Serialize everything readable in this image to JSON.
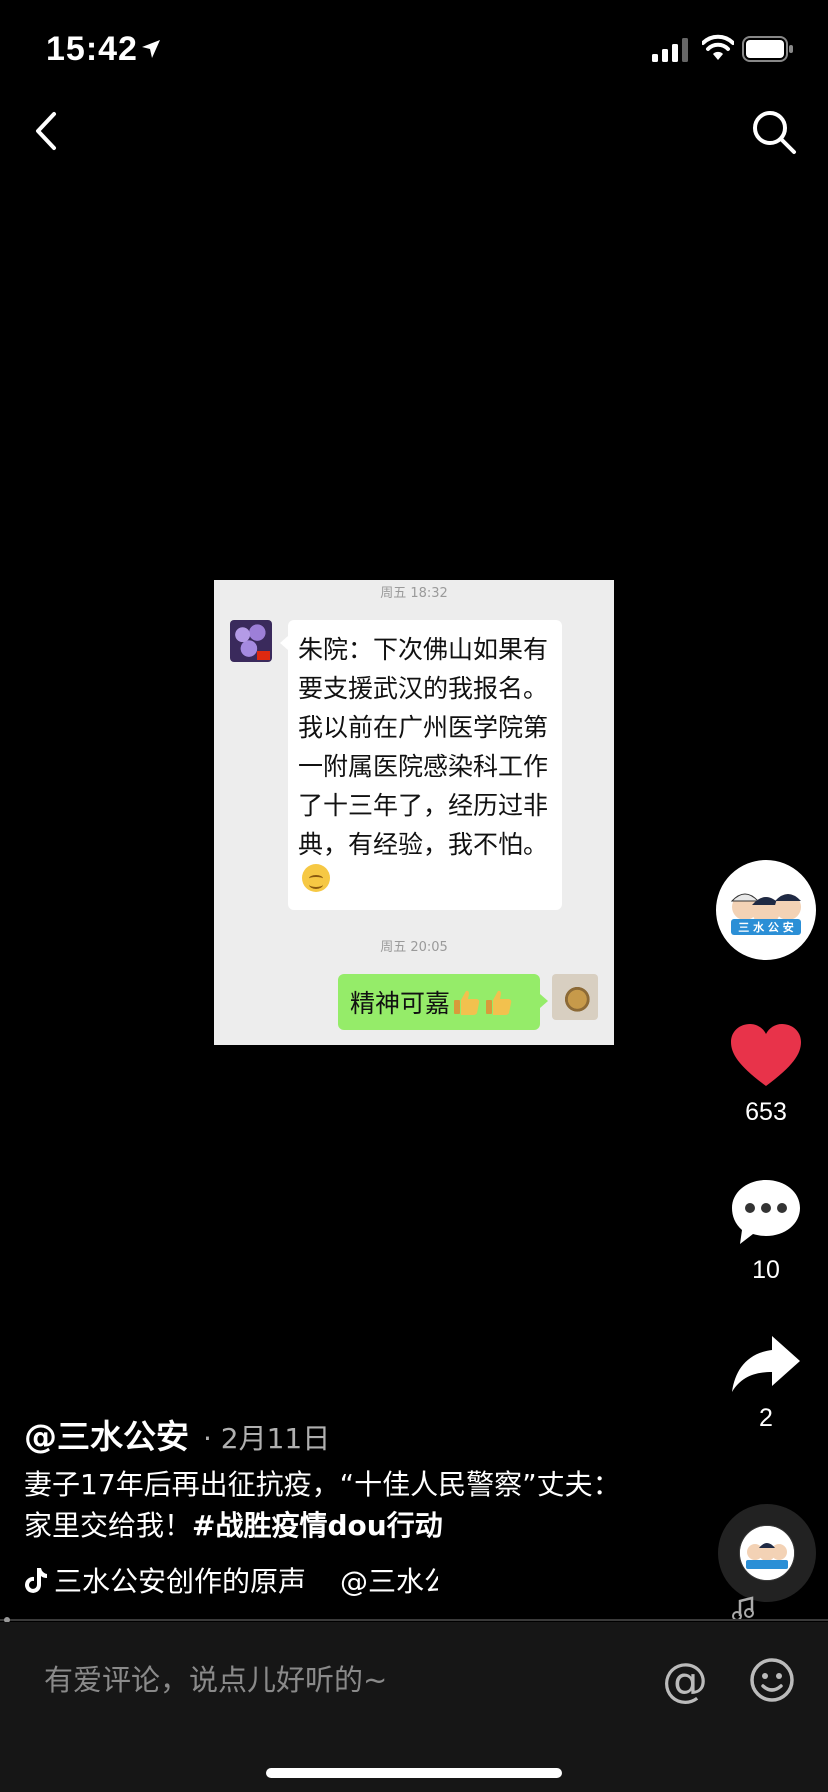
{
  "status_bar": {
    "time": "15:42"
  },
  "chat": {
    "time_1": "周五 18:32",
    "message_left": "朱院：下次佛山如果有要支援武汉的我报名。我以前在广州医学院第一附属医院感染科工作了十三年了，经历过非典，有经验，我不怕。",
    "time_2": "周五 20:05",
    "message_right": "精神可嘉"
  },
  "actions": {
    "likes": "653",
    "comments": "10",
    "shares": "2"
  },
  "post": {
    "author": "@三水公安",
    "date": "· 2月11日",
    "caption": "妻子17年后再出征抗疫，“十佳人民警察”丈夫：家里交给我！",
    "hashtag": "#战胜疫情dou行动",
    "music": "三水公安创作的原声",
    "music_mention": "@三水公安"
  },
  "comment_bar": {
    "placeholder": "有爱评论，说点儿好听的~"
  },
  "colors": {
    "like": "#e8334a",
    "bubble_green": "#95ec69",
    "chat_bg": "#ededed"
  },
  "icons": [
    "back-icon",
    "search-icon",
    "heart-icon",
    "comment-icon",
    "share-icon",
    "at-icon",
    "emoji-icon",
    "tiktok-icon",
    "music-note-icon"
  ]
}
